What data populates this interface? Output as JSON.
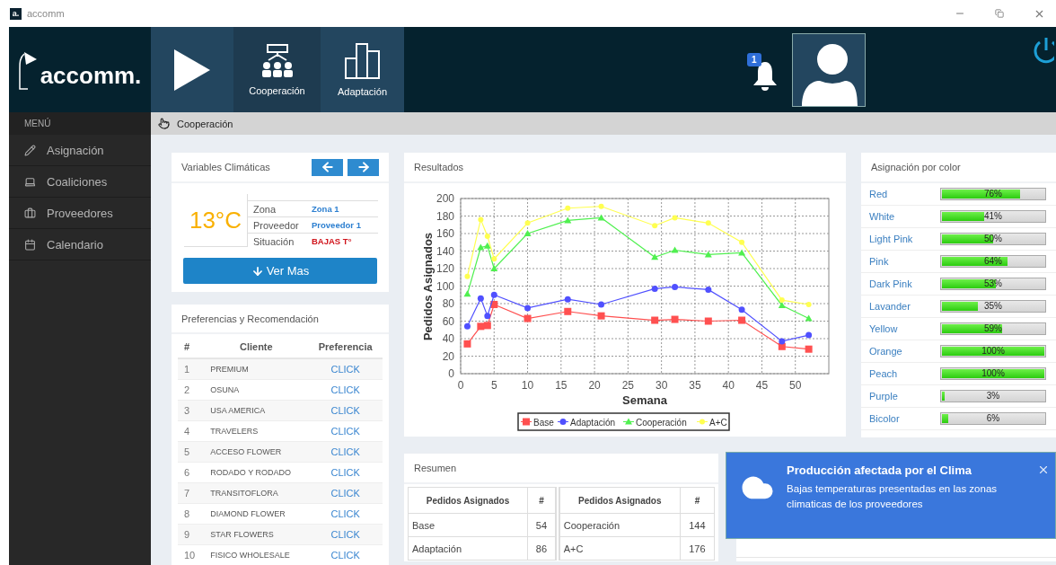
{
  "window": {
    "logo_mark": "a.",
    "title": "accomm"
  },
  "header": {
    "logo": "accomm.",
    "tabs": [
      {
        "kind": "play",
        "selected": false
      },
      {
        "kind": "team",
        "label": "Cooperación",
        "selected": true
      },
      {
        "kind": "bars",
        "label": "Adaptación",
        "selected": false
      }
    ],
    "notification_count": "1"
  },
  "sidebar": {
    "heading": "MENÚ",
    "items": [
      {
        "kind": "pencil",
        "label": "Asignación"
      },
      {
        "kind": "laptop",
        "label": "Coaliciones"
      },
      {
        "kind": "briefcase",
        "label": "Proveedores"
      },
      {
        "kind": "calendar",
        "label": "Calendario"
      }
    ]
  },
  "breadcrumb": "Cooperación",
  "climate": {
    "title": "Variables Climáticas",
    "temperature": "13°C",
    "rows": [
      {
        "label": "Zona",
        "value": "Zona 1",
        "alert": false
      },
      {
        "label": "Proveedor",
        "value": "Proveedor 1",
        "alert": false
      },
      {
        "label": "Situación",
        "value": "BAJAS T°",
        "alert": true
      }
    ],
    "button": "Ver Mas"
  },
  "preferences": {
    "title": "Preferencias y Recomendación",
    "columns": [
      "#",
      "Cliente",
      "Preferencia"
    ],
    "rows": [
      [
        "1",
        "PREMIUM",
        "CLICK"
      ],
      [
        "2",
        "OSUNA",
        "CLICK"
      ],
      [
        "3",
        "USA AMERICA",
        "CLICK"
      ],
      [
        "4",
        "TRAVELERS",
        "CLICK"
      ],
      [
        "5",
        "ACCESO FLOWER",
        "CLICK"
      ],
      [
        "6",
        "RODADO Y RODADO",
        "CLICK"
      ],
      [
        "7",
        "TRANSITOFLORA",
        "CLICK"
      ],
      [
        "8",
        "DIAMOND FLOWER",
        "CLICK"
      ],
      [
        "9",
        "STAR FLOWERS",
        "CLICK"
      ],
      [
        "10",
        "FISICO WHOLESALE",
        "CLICK"
      ]
    ]
  },
  "results": {
    "title": "Resultados",
    "chart_data": {
      "type": "line",
      "grid": true,
      "legend": true,
      "xlabel": "Semana",
      "ylabel": "Pedidos Asignados",
      "x": [
        1,
        3,
        4,
        5,
        10,
        16,
        21,
        29,
        32,
        37,
        42,
        48,
        52
      ],
      "xlim": [
        0,
        55
      ],
      "ylim": [
        0,
        200
      ],
      "xticks": [
        0,
        5,
        10,
        15,
        20,
        25,
        30,
        35,
        40,
        45,
        50
      ],
      "yticks": [
        0,
        20,
        40,
        60,
        80,
        100,
        120,
        140,
        160,
        180,
        200
      ],
      "series": [
        {
          "name": "Base",
          "color": "#ff5050",
          "marker": "square",
          "values": [
            34,
            54,
            55,
            79,
            63,
            71,
            66,
            61,
            62,
            60,
            61,
            31,
            28
          ]
        },
        {
          "name": "Adaptación",
          "color": "#5050ff",
          "marker": "circle",
          "values": [
            54,
            86,
            66,
            90,
            75,
            85,
            79,
            97,
            99,
            96,
            73,
            37,
            44
          ]
        },
        {
          "name": "Cooperación",
          "color": "#50f050",
          "marker": "triangle",
          "values": [
            91,
            144,
            146,
            120,
            160,
            175,
            178,
            133,
            141,
            136,
            138,
            78,
            63
          ]
        },
        {
          "name": "A+C",
          "color": "#ffff50",
          "marker": "dot",
          "values": [
            111,
            176,
            157,
            131,
            172,
            189,
            191,
            169,
            178,
            172,
            150,
            84,
            79
          ]
        }
      ]
    }
  },
  "colors": {
    "title": "Asignación por color",
    "items": [
      {
        "name": "Red",
        "level": 0.76,
        "reading": "76%"
      },
      {
        "name": "White",
        "level": 0.41,
        "reading": "41%"
      },
      {
        "name": "Light Pink",
        "level": 0.5,
        "reading": "50%"
      },
      {
        "name": "Pink",
        "level": 0.64,
        "reading": "64%"
      },
      {
        "name": "Dark Pink",
        "level": 0.53,
        "reading": "53%"
      },
      {
        "name": "Lavander",
        "level": 0.35,
        "reading": "35%"
      },
      {
        "name": "Yellow",
        "level": 0.59,
        "reading": "59%"
      },
      {
        "name": "Orange",
        "level": 1,
        "reading": "100%"
      },
      {
        "name": "Peach",
        "level": 1,
        "reading": "100%"
      },
      {
        "name": "Purple",
        "level": 0.03,
        "reading": "3%"
      },
      {
        "name": "Bicolor",
        "level": 0.06,
        "reading": "6%"
      }
    ]
  },
  "summary": {
    "title": "Resumen",
    "columns": [
      "Pedidos Asignados",
      "#",
      "Pedidos Asignados",
      "#"
    ],
    "rows": [
      [
        "Base",
        "54",
        "Cooperación",
        "144"
      ],
      [
        "Adaptación",
        "86",
        "A+C",
        "176"
      ]
    ]
  },
  "notification": {
    "title": "Producción afectada por el Clima",
    "text": "Bajas temperaturas presentadas en las zonas climaticas de los proveedores"
  }
}
